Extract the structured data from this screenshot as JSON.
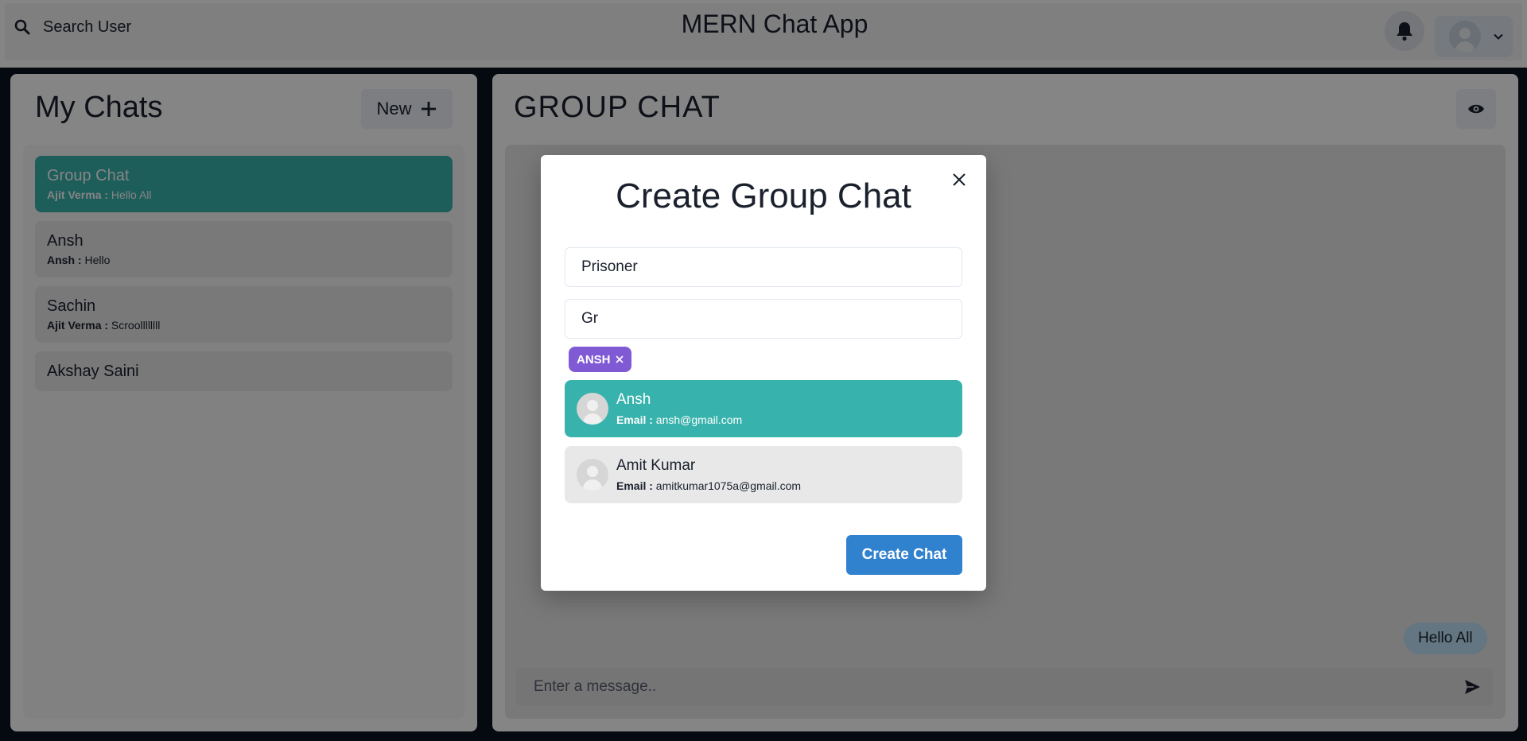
{
  "header": {
    "search_label": "Search User",
    "app_title": "MERN Chat App"
  },
  "sidebar": {
    "title": "My Chats",
    "new_button_label": "New",
    "chats": [
      {
        "name": "Group Chat",
        "sender": "Ajit Verma :",
        "message": "Hello All",
        "active": true
      },
      {
        "name": "Ansh",
        "sender": "Ansh :",
        "message": "Hello",
        "active": false
      },
      {
        "name": "Sachin",
        "sender": "Ajit Verma :",
        "message": "Scroollllllll",
        "active": false
      },
      {
        "name": "Akshay Saini",
        "sender": "",
        "message": "",
        "active": false
      }
    ]
  },
  "chat": {
    "title": "GROUP CHAT",
    "messages": [
      {
        "text": "Hello All"
      }
    ],
    "input_placeholder": "Enter a message.."
  },
  "modal": {
    "title": "Create Group Chat",
    "chat_name_value": "Prisoner",
    "search_value": "Gr",
    "selected_users": [
      {
        "label": "ANSH"
      }
    ],
    "results": [
      {
        "name": "Ansh",
        "email_label": "Email :",
        "email": "ansh@gmail.com",
        "highlighted": true
      },
      {
        "name": "Amit Kumar",
        "email_label": "Email :",
        "email": "amitkumar1075a@gmail.com",
        "highlighted": false
      }
    ],
    "create_button_label": "Create Chat"
  },
  "colors": {
    "accent_teal": "#38b2ac",
    "badge_purple": "#805ad5",
    "primary_blue": "#3182ce",
    "bubble_blue": "#bee3f8"
  },
  "icons": {
    "search": "search-icon",
    "bell": "bell-icon",
    "chevron": "chevron-down-icon",
    "plus": "plus-icon",
    "eye": "eye-icon",
    "send": "send-icon",
    "close": "close-icon"
  }
}
